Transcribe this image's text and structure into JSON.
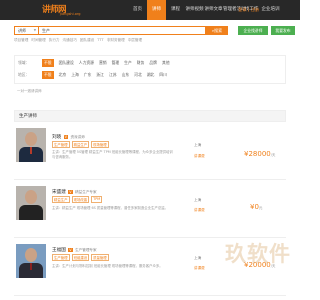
{
  "brand": {
    "name": "讲师网",
    "sub": "Jiangshi.org"
  },
  "nav": [
    "首页",
    "讲师",
    "课程",
    "讲师视频",
    "讲师文章",
    "管理者活动",
    "找工作",
    "企业培训"
  ],
  "login": "登录 | 注册",
  "search": {
    "type": "讲师",
    "value": "生产",
    "button": "搜索",
    "ent_button": "企业找讲师",
    "my_button": "我要发布"
  },
  "hot": [
    "项目管理",
    "时间管理",
    "执行力",
    "沟通技巧",
    "团队建设",
    "TTT",
    "非财务管理",
    "中层管理"
  ],
  "filters": {
    "field_label": "领域：",
    "field": [
      "不限",
      "团队建设",
      "人力资源",
      "营销",
      "管理",
      "生产",
      "财务",
      "品牌",
      "其他"
    ],
    "region_label": "地区：",
    "region": [
      "不限",
      "北京",
      "上海",
      "广东",
      "浙江",
      "江苏",
      "山东",
      "河北",
      "湖北",
      "四川"
    ]
  },
  "oneclick": "一对一邀请讲师",
  "section_title": "生产讲师",
  "lecturers": [
    {
      "name": "刘晓",
      "vip": "V",
      "title": "资深讲师",
      "tags": [
        "生产管理",
        "精益生产",
        "现场管理"
      ],
      "desc": "主讲：生产管理 5S管理 精益生产 TPM 班组长管理等课程，为众多企业提供培训与咨询服务。",
      "location": "上海",
      "fee_label": "讲课费",
      "price": "¥28000",
      "price_unit": "/天"
    },
    {
      "name": "宋盛建",
      "vip": "V",
      "title": "精益生产专家",
      "tags": [
        "精益生产",
        "现场改善",
        "TPM"
      ],
      "desc": "主讲：精益生产 现场管理 6S 质量管理等课程，曾任多家制造企业生产总监。",
      "location": "上海",
      "fee_label": "讲课费",
      "price": "¥0",
      "price_unit": "元"
    },
    {
      "name": "王福国",
      "vip": "V",
      "title": "生产管理专家",
      "tags": [
        "生产管理",
        "班组建设",
        "质量管理"
      ],
      "desc": "主讲：生产计划与物料控制 班组长管理 现场管理等课程，服务客户众多。",
      "location": "上海",
      "fee_label": "讲课费",
      "price": "¥20000",
      "price_unit": "/天"
    }
  ],
  "watermark": "玖软件"
}
